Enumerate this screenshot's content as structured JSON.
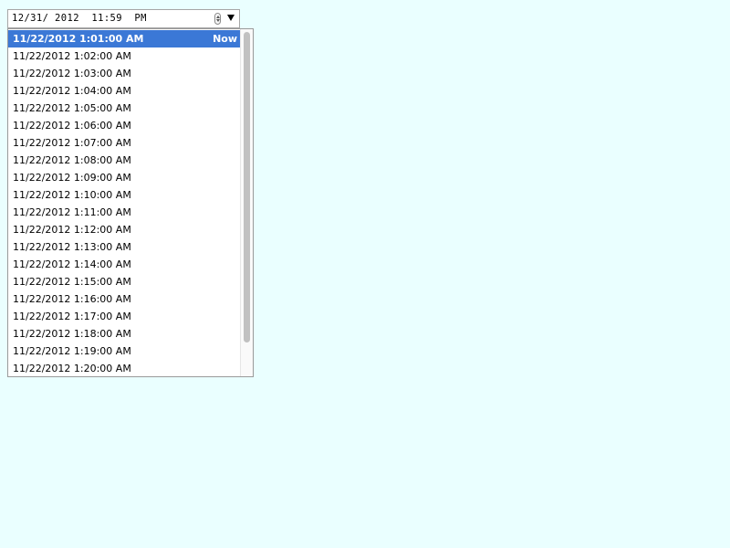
{
  "datetime_input": {
    "value": "12/31/ 2012  11:59  PM"
  },
  "icons": {
    "spinner": "up-down-spin-icon",
    "dropdown": "dropdown-arrow-icon"
  },
  "popup": {
    "now_label": "Now",
    "selected_index": 0,
    "items": [
      "11/22/2012 1:01:00 AM",
      "11/22/2012 1:02:00 AM",
      "11/22/2012 1:03:00 AM",
      "11/22/2012 1:04:00 AM",
      "11/22/2012 1:05:00 AM",
      "11/22/2012 1:06:00 AM",
      "11/22/2012 1:07:00 AM",
      "11/22/2012 1:08:00 AM",
      "11/22/2012 1:09:00 AM",
      "11/22/2012 1:10:00 AM",
      "11/22/2012 1:11:00 AM",
      "11/22/2012 1:12:00 AM",
      "11/22/2012 1:13:00 AM",
      "11/22/2012 1:14:00 AM",
      "11/22/2012 1:15:00 AM",
      "11/22/2012 1:16:00 AM",
      "11/22/2012 1:17:00 AM",
      "11/22/2012 1:18:00 AM",
      "11/22/2012 1:19:00 AM",
      "11/22/2012 1:20:00 AM"
    ]
  },
  "colors": {
    "page_background": "#eaffff",
    "selection": "#3b78d6"
  }
}
